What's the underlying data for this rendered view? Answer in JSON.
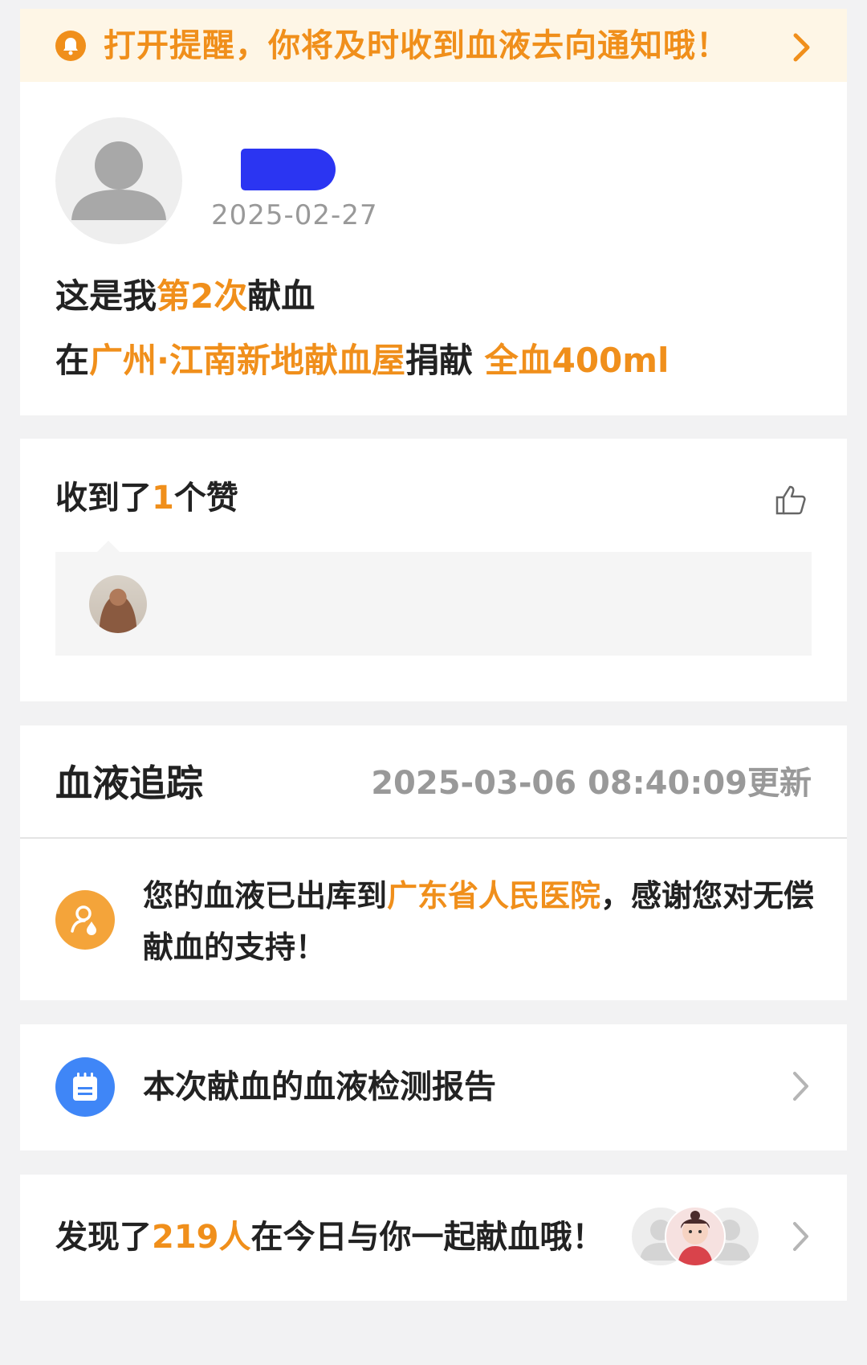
{
  "notice": {
    "text": "打开提醒，你将及时收到血液去向通知哦！",
    "icon": "bell-icon",
    "arrow_icon": "chevron-right-icon"
  },
  "donor": {
    "date": "2025-02-27",
    "line1_prefix": "这是我",
    "line1_count": "第2次",
    "line1_suffix": "献血",
    "line2_prefix": "在",
    "line2_location": "广州·江南新地献血屋",
    "line2_mid": "捐献 ",
    "line2_amount": "全血400ml"
  },
  "likes": {
    "prefix": "收到了",
    "count": "1",
    "suffix": "个赞",
    "icon": "thumbs-up-icon"
  },
  "tracking": {
    "title": "血液追踪",
    "updated": "2025-03-06 08:40:09更新",
    "msg_prefix": "您的血液已出库到",
    "msg_hospital": "广东省人民医院",
    "msg_suffix": "，感谢您对无偿献血的支持！"
  },
  "report": {
    "label": "本次献血的血液检测报告"
  },
  "together": {
    "prefix": "发现了",
    "count": "219人",
    "suffix": "在今日与你一起献血哦！"
  },
  "colors": {
    "accent": "#f08f1b",
    "notice_bg": "#fef6e6",
    "report_icon": "#3f86f7",
    "redaction": "#2b35f2"
  }
}
